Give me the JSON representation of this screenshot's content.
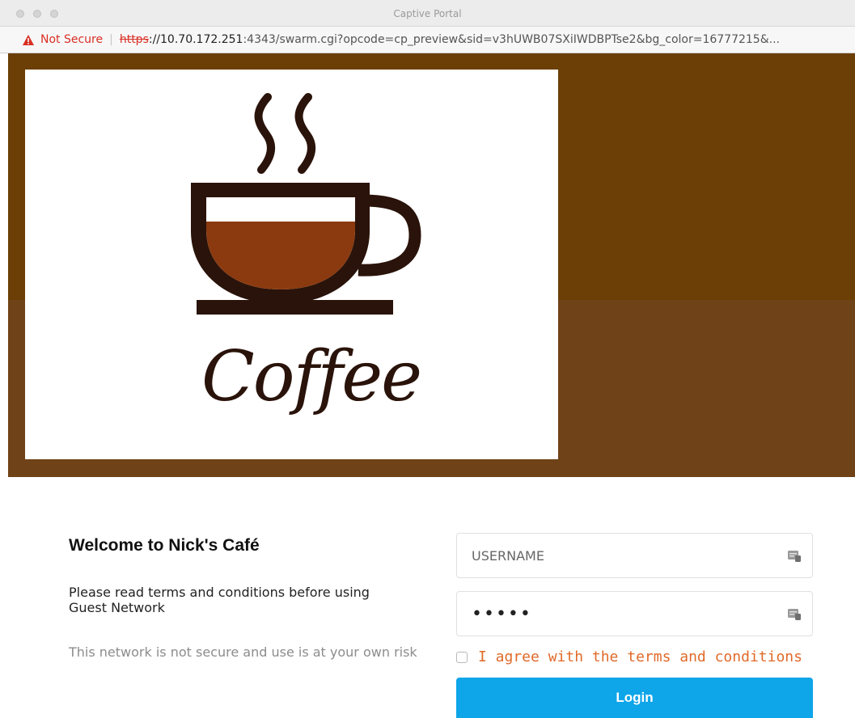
{
  "window": {
    "title": "Captive Portal"
  },
  "address_bar": {
    "security_label": "Not Secure",
    "separator": "|",
    "protocol": "https",
    "host": "://10.70.172.251",
    "rest": ":4343/swarm.cgi?opcode=cp_preview&sid=v3hUWB07SXiIWDBPTse2&bg_color=16777215&..."
  },
  "banner": {
    "logo_text": "Coffee",
    "top_color": "#6b3f05",
    "bottom_color": "#6f4317"
  },
  "content": {
    "welcome": "Welcome to Nick's Café",
    "terms_notice": "Please read terms and conditions before using Guest Network",
    "risk_notice": "This network is not secure and use is at your own risk"
  },
  "form": {
    "username_placeholder": "USERNAME",
    "password_value": "•••••",
    "agree_label": "I agree with the terms and conditions",
    "login_label": "Login",
    "login_color": "#0ea5e9"
  },
  "icons": {
    "warning": "warning-triangle-icon",
    "field": "keycard-icon"
  }
}
